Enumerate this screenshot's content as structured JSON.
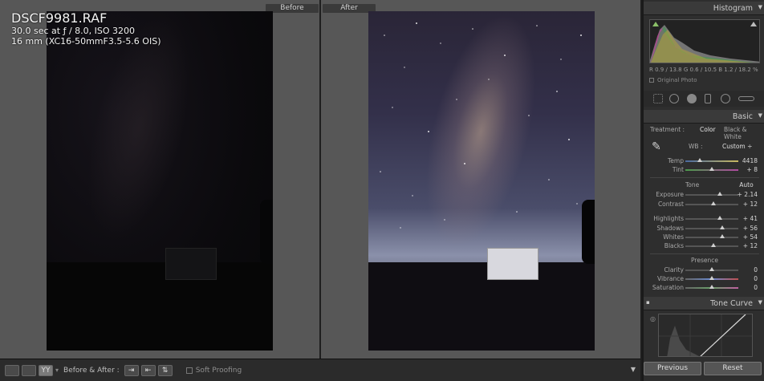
{
  "view": {
    "before_label": "Before",
    "after_label": "After"
  },
  "overlay": {
    "filename": "DSCF9981.RAF",
    "exposure": "30.0 sec at ƒ / 8.0, ISO 3200",
    "lens": "16 mm (XC16-50mmF3.5-5.6 OIS)"
  },
  "toolbar": {
    "view_button_1": "YY",
    "before_after_label": "Before & After :",
    "soft_proofing_label": "Soft Proofing",
    "soft_proofing_checked": false
  },
  "histogram": {
    "title": "Histogram",
    "readout": "R  0.9 / 13.8   G  0.6 / 10.5   B  1.2 / 18.2  %",
    "original_photo_label": "Original Photo"
  },
  "basic": {
    "title": "Basic",
    "treatment_label": "Treatment :",
    "treatment_color": "Color",
    "treatment_bw": "Black & White",
    "wb_label": "WB :",
    "wb_value": "Custom ÷",
    "temp_label": "Temp",
    "temp_value": "4418",
    "tint_label": "Tint",
    "tint_value": "+ 8",
    "tone_label": "Tone",
    "auto_label": "Auto",
    "exposure_label": "Exposure",
    "exposure_value": "+ 2.14",
    "contrast_label": "Contrast",
    "contrast_value": "+ 12",
    "highlights_label": "Highlights",
    "highlights_value": "+ 41",
    "shadows_label": "Shadows",
    "shadows_value": "+ 56",
    "whites_label": "Whites",
    "whites_value": "+ 54",
    "blacks_label": "Blacks",
    "blacks_value": "+ 12",
    "presence_label": "Presence",
    "clarity_label": "Clarity",
    "clarity_value": "0",
    "vibrance_label": "Vibrance",
    "vibrance_value": "0",
    "saturation_label": "Saturation",
    "saturation_value": "0"
  },
  "tone_curve": {
    "title": "Tone Curve"
  },
  "buttons": {
    "previous": "Previous",
    "reset": "Reset"
  },
  "colors": {
    "panel_bg": "#2e2e2e",
    "view_bg": "#575757",
    "accent_highlight": "#e6e6e6"
  }
}
